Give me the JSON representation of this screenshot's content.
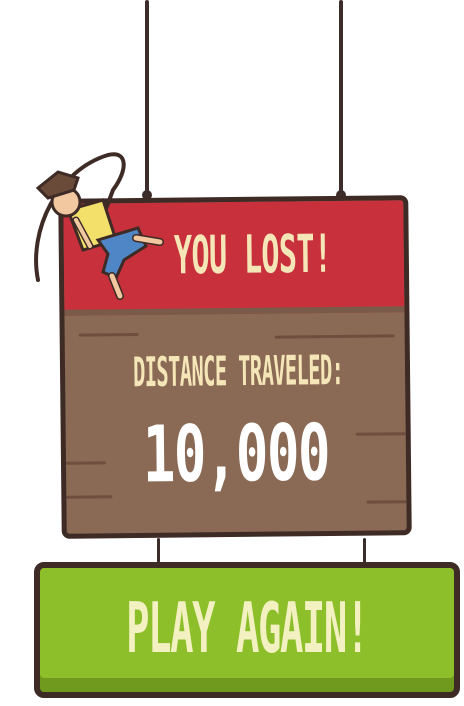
{
  "game_over": {
    "header_text": "YOU LOST!",
    "distance_label": "DISTANCE TRAVELED:",
    "distance_value": "10,000"
  },
  "actions": {
    "play_again_label": "PLAY AGAIN!"
  },
  "character": {
    "icon": "fallen-explorer-icon"
  },
  "colors": {
    "header_red": "#c8303b",
    "wood_brown": "#8a6a55",
    "border_dark": "#3e2b26",
    "text_cream": "#f5e6b8",
    "button_green": "#8dbf2a"
  }
}
